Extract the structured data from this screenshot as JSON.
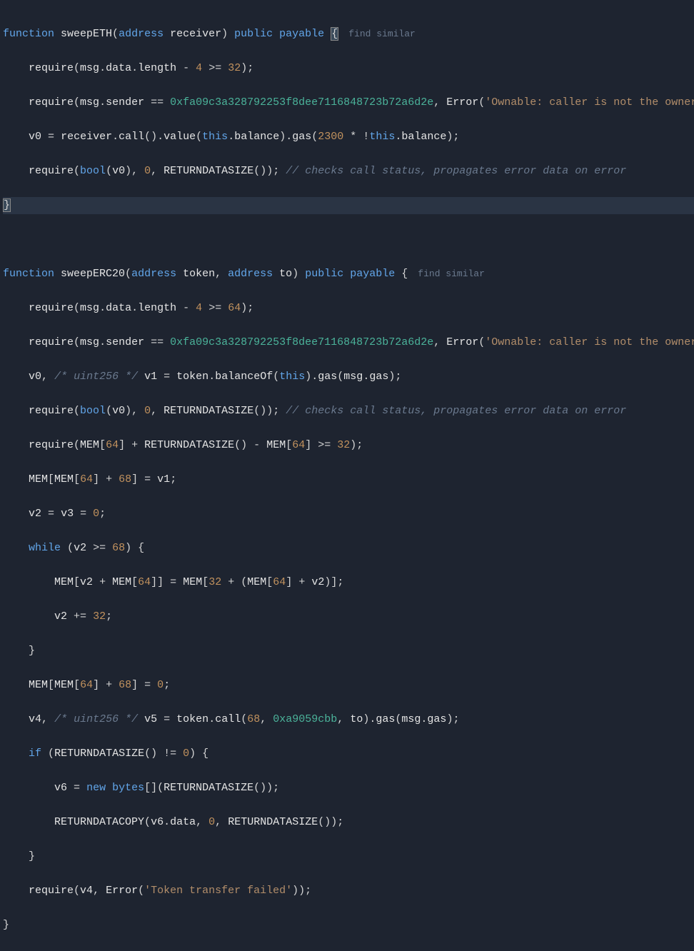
{
  "fn1": {
    "kw_function": "function",
    "name": "sweepETH",
    "kw_type1": "address",
    "param1": "receiver",
    "kw_public": "public",
    "kw_payable": "payable",
    "find_similar": "find similar",
    "l1_require": "require",
    "l1_msg": "msg",
    "l1_data": "data",
    "l1_length": "length",
    "l1_n4": "4",
    "l1_n32": "32",
    "l2_require": "require",
    "l2_msg": "msg",
    "l2_sender": "sender",
    "l2_addr": "0xfa09c3a328792253f8dee7116848723b72a6d2e",
    "l2_error": "Error",
    "l2_str": "'Ownable: caller is not the owner'",
    "l3_v0": "v0",
    "l3_receiver": "receiver",
    "l3_call": "call",
    "l3_value": "value",
    "l3_this": "this",
    "l3_balance": "balance",
    "l3_gas": "gas",
    "l3_n2300": "2300",
    "l3_this2": "this",
    "l3_balance2": "balance",
    "l4_require": "require",
    "l4_bool": "bool",
    "l4_v0": "v0",
    "l4_n0": "0",
    "l4_rds": "RETURNDATASIZE",
    "l4_comment": "// checks call status, propagates error data on error"
  },
  "fn2": {
    "kw_function": "function",
    "name": "sweepERC20",
    "kw_type1": "address",
    "param1": "token",
    "kw_type2": "address",
    "param2": "to",
    "kw_public": "public",
    "kw_payable": "payable",
    "find_similar": "find similar",
    "l1_require": "require",
    "l1_msg": "msg",
    "l1_data": "data",
    "l1_length": "length",
    "l1_n4": "4",
    "l1_n64": "64",
    "l2_require": "require",
    "l2_msg": "msg",
    "l2_sender": "sender",
    "l2_addr": "0xfa09c3a328792253f8dee7116848723b72a6d2e",
    "l2_error": "Error",
    "l2_str": "'Ownable: caller is not the owner'",
    "l3_v0": "v0",
    "l3_c": "/* uint256 */",
    "l3_v1": "v1",
    "l3_token": "token",
    "l3_balanceOf": "balanceOf",
    "l3_this": "this",
    "l3_gas": "gas",
    "l3_msg": "msg",
    "l3_mgas": "gas",
    "l4_require": "require",
    "l4_bool": "bool",
    "l4_v0": "v0",
    "l4_n0": "0",
    "l4_rds": "RETURNDATASIZE",
    "l4_comment": "// checks call status, propagates error data on error",
    "l5_require": "require",
    "l5_mem1": "MEM",
    "l5_n64a": "64",
    "l5_rds": "RETURNDATASIZE",
    "l5_mem2": "MEM",
    "l5_n64b": "64",
    "l5_n32": "32",
    "l6_mem1": "MEM",
    "l6_mem2": "MEM",
    "l6_n64": "64",
    "l6_n68": "68",
    "l6_v1": "v1",
    "l7_v2": "v2",
    "l7_v3": "v3",
    "l7_n0": "0",
    "l8_while": "while",
    "l8_v2": "v2",
    "l8_n68": "68",
    "l9_mem1": "MEM",
    "l9_v2a": "v2",
    "l9_mem2": "MEM",
    "l9_n64a": "64",
    "l9_mem3": "MEM",
    "l9_n32": "32",
    "l9_mem4": "MEM",
    "l9_n64b": "64",
    "l9_v2b": "v2",
    "l10_v2": "v2",
    "l10_n32": "32",
    "l11_mem1": "MEM",
    "l11_mem2": "MEM",
    "l11_n64": "64",
    "l11_n68": "68",
    "l11_n0": "0",
    "l12_v4": "v4",
    "l12_c": "/* uint256 */",
    "l12_v5": "v5",
    "l12_token": "token",
    "l12_call": "call",
    "l12_n68": "68",
    "l12_hex": "0xa9059cbb",
    "l12_to": "to",
    "l12_gas": "gas",
    "l12_msg": "msg",
    "l12_mgas": "gas",
    "l13_if": "if",
    "l13_rds": "RETURNDATASIZE",
    "l13_n0": "0",
    "l14_v6": "v6",
    "l14_new": "new",
    "l14_bytes": "bytes",
    "l14_rds": "RETURNDATASIZE",
    "l15_rdc": "RETURNDATACOPY",
    "l15_v6": "v6",
    "l15_data": "data",
    "l15_n0": "0",
    "l15_rds": "RETURNDATASIZE",
    "l16_require": "require",
    "l16_v4": "v4",
    "l16_error": "Error",
    "l16_str": "'Token transfer failed'"
  }
}
